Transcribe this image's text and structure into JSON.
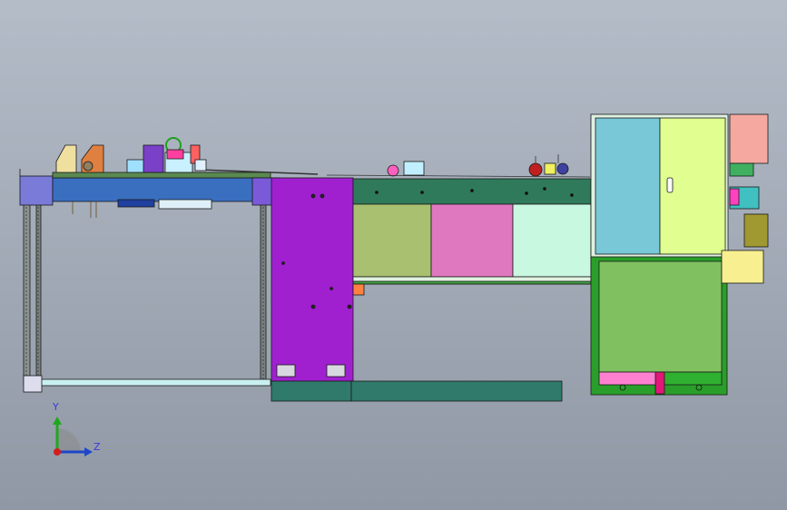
{
  "viewport": {
    "background_top": "#b4bcc8",
    "background_bottom": "#8f98a4"
  },
  "triad": {
    "y_label": "Y",
    "z_label": "Z",
    "y_color": "#1ea81e",
    "z_color": "#1e46c8",
    "x_color": "#d21e1e",
    "label_color": "#3a3adc"
  },
  "cabinet": {
    "handle_icon": "door-handle-icon"
  },
  "colors": {
    "frame_blue": "#3a6fc0",
    "base_green": "#2f7a6a",
    "purple_panel": "#a020d0",
    "green_cabinet": "#2a9e2a",
    "panel_olive": "#a8c070",
    "panel_pink": "#e078c0",
    "panel_mint": "#c8f8e0",
    "door_teal": "#78c8d8",
    "door_lime": "#e0ff90",
    "door_green": "#80c060",
    "salmon": "#f4a8a0"
  }
}
